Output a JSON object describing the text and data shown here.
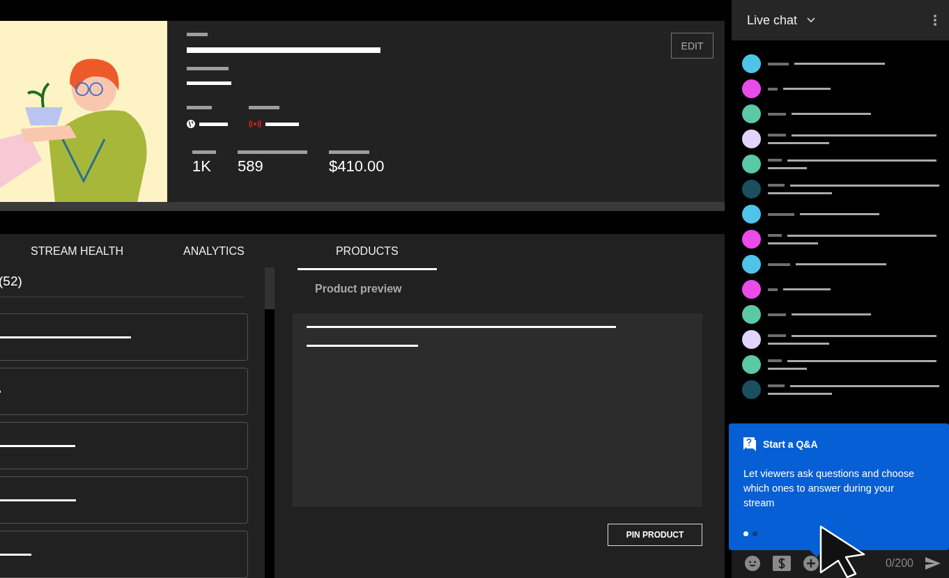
{
  "stream": {
    "edit_button": "EDIT",
    "stats": [
      {
        "value": "1K"
      },
      {
        "value": "589"
      },
      {
        "value": "$410.00"
      }
    ]
  },
  "tabs": [
    {
      "label": "STREAM HEALTH",
      "selected": false
    },
    {
      "label": "ANALYTICS",
      "selected": false
    },
    {
      "label": "PRODUCTS",
      "selected": true
    }
  ],
  "products": {
    "count_heading": "(52)",
    "preview_title": "Product preview",
    "pin_button": "PIN PRODUCT"
  },
  "chat": {
    "title": "Live chat",
    "counter": "0/200",
    "messages": [
      {
        "color": "#4fc3e8",
        "kind": "single"
      },
      {
        "color": "#e94ce9",
        "kind": "single"
      },
      {
        "color": "#5bc8a8",
        "kind": "single"
      },
      {
        "color": "#e1d4fa",
        "kind": "double"
      },
      {
        "color": "#5bc8a8",
        "kind": "double"
      },
      {
        "color": "#1b4f5f",
        "kind": "double"
      },
      {
        "color": "#4fc3e8",
        "kind": "single"
      },
      {
        "color": "#e94ce9",
        "kind": "double"
      },
      {
        "color": "#4fc3e8",
        "kind": "single"
      },
      {
        "color": "#e94ce9",
        "kind": "single"
      },
      {
        "color": "#5bc8a8",
        "kind": "single"
      },
      {
        "color": "#e1d4fa",
        "kind": "double"
      },
      {
        "color": "#5bc8a8",
        "kind": "double"
      },
      {
        "color": "#1b4f5f",
        "kind": "double"
      }
    ]
  },
  "qa_popup": {
    "title": "Start a Q&A",
    "body": "Let viewers ask questions and choose which ones to answer during your stream",
    "pages": [
      {
        "selected": true
      },
      {
        "selected": false
      }
    ]
  }
}
